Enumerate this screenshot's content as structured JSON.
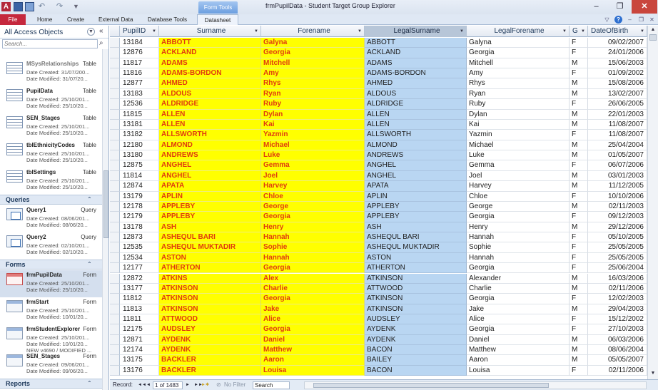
{
  "window": {
    "app_letter": "A",
    "title": "frmPupilData - Student Target Group Explorer",
    "context_tab": "Form Tools"
  },
  "ribbon": {
    "tabs": [
      "File",
      "Home",
      "Create",
      "External Data",
      "Database Tools",
      "Datasheet"
    ]
  },
  "nav": {
    "header": "All Access Objects",
    "search_placeholder": "Search...",
    "items_top": [
      {
        "name": "",
        "type": "",
        "line1": "Date Modified: 31/07/20...",
        "line2": "",
        "line3": "",
        "icon": "table"
      },
      {
        "name": "MSysRelationships",
        "type": "Table",
        "line1": "Date Created: 31/07/200...",
        "line2": "Date Modified: 31/07/20...",
        "line3": "",
        "icon": "table",
        "dim": true
      },
      {
        "name": "PupilData",
        "type": "Table",
        "line1": "Date Created: 25/10/201...",
        "line2": "Date Modified: 25/10/20...",
        "line3": "",
        "icon": "table"
      },
      {
        "name": "SEN_Stages",
        "type": "Table",
        "line1": "Date Created: 25/10/201...",
        "line2": "Date Modified: 25/10/20...",
        "line3": "",
        "icon": "table"
      },
      {
        "name": "tblEthnicityCodes",
        "type": "Table",
        "line1": "Date Created: 25/10/201...",
        "line2": "Date Modified: 25/10/20...",
        "line3": "",
        "icon": "table"
      },
      {
        "name": "tblSettings",
        "type": "Table",
        "line1": "Date Created: 25/10/201...",
        "line2": "Date Modified: 25/10/20...",
        "line3": "",
        "icon": "table"
      }
    ],
    "queries_title": "Queries",
    "queries": [
      {
        "name": "Query1",
        "type": "Query",
        "line1": "Date Created: 08/06/201...",
        "line2": "Date Modified: 08/06/20...",
        "line3": ""
      },
      {
        "name": "Query2",
        "type": "Query",
        "line1": "Date Created: 02/10/201...",
        "line2": "Date Modified: 02/10/20...",
        "line3": ""
      }
    ],
    "forms_title": "Forms",
    "forms": [
      {
        "name": "frmPupilData",
        "type": "Form",
        "line1": "Date Created: 25/10/201...",
        "line2": "Date Modified: 25/10/20...",
        "line3": "",
        "selected": true
      },
      {
        "name": "frmStart",
        "type": "Form",
        "line1": "Date Created: 25/10/201...",
        "line2": "Date Modified: 10/01/20...",
        "line3": ""
      },
      {
        "name": "frmStudentExplorer",
        "type": "Form",
        "line1": "Date Created: 25/10/201...",
        "line2": "Date Modified: 10/01/20...",
        "line3": "NEW v4690 / MODIFIED ..."
      },
      {
        "name": "SEN_Stages",
        "type": "Form",
        "line1": "Date Created: 09/06/201...",
        "line2": "Date Modified: 09/06/20...",
        "line3": ""
      }
    ],
    "reports_title": "Reports"
  },
  "grid": {
    "columns": [
      "PupilID",
      "Surname",
      "Forename",
      "LegalSurname",
      "LegalForename",
      "G",
      "DateOfBirth"
    ],
    "rows": [
      [
        "13184",
        "ABBOTT",
        "Galyna",
        "ABBOTT",
        "Galyna",
        "F",
        "09/02/2007"
      ],
      [
        "12876",
        "ACKLAND",
        "Georgia",
        "ACKLAND",
        "Georgia",
        "F",
        "24/01/2006"
      ],
      [
        "11817",
        "ADAMS",
        "Mitchell",
        "ADAMS",
        "Mitchell",
        "M",
        "15/06/2003"
      ],
      [
        "11816",
        "ADAMS-BORDON",
        "Amy",
        "ADAMS-BORDON",
        "Amy",
        "F",
        "01/09/2002"
      ],
      [
        "12877",
        "AHMED",
        "Rhys",
        "AHMED",
        "Rhys",
        "M",
        "15/08/2006"
      ],
      [
        "13183",
        "ALDOUS",
        "Ryan",
        "ALDOUS",
        "Ryan",
        "M",
        "13/02/2007"
      ],
      [
        "12536",
        "ALDRIDGE",
        "Ruby",
        "ALDRIDGE",
        "Ruby",
        "F",
        "26/06/2005"
      ],
      [
        "11815",
        "ALLEN",
        "Dylan",
        "ALLEN",
        "Dylan",
        "M",
        "22/01/2003"
      ],
      [
        "13181",
        "ALLEN",
        "Kai",
        "ALLEN",
        "Kai",
        "M",
        "11/08/2007"
      ],
      [
        "13182",
        "ALLSWORTH",
        "Yazmin",
        "ALLSWORTH",
        "Yazmin",
        "F",
        "11/08/2007"
      ],
      [
        "12180",
        "ALMOND",
        "Michael",
        "ALMOND",
        "Michael",
        "M",
        "25/04/2004"
      ],
      [
        "13180",
        "ANDREWS",
        "Luke",
        "ANDREWS",
        "Luke",
        "M",
        "01/05/2007"
      ],
      [
        "12875",
        "ANGHEL",
        "Gemma",
        "ANGHEL",
        "Gemma",
        "F",
        "06/07/2006"
      ],
      [
        "11814",
        "ANGHEL",
        "Joel",
        "ANGHEL",
        "Joel",
        "M",
        "03/01/2003"
      ],
      [
        "12874",
        "APATA",
        "Harvey",
        "APATA",
        "Harvey",
        "M",
        "11/12/2005"
      ],
      [
        "13179",
        "APLIN",
        "Chloe",
        "APLIN",
        "Chloe",
        "F",
        "10/10/2006"
      ],
      [
        "12178",
        "APPLEBY",
        "George",
        "APPLEBY",
        "George",
        "M",
        "02/11/2003"
      ],
      [
        "12179",
        "APPLEBY",
        "Georgia",
        "APPLEBY",
        "Georgia",
        "F",
        "09/12/2003"
      ],
      [
        "13178",
        "ASH",
        "Henry",
        "ASH",
        "Henry",
        "M",
        "29/12/2006"
      ],
      [
        "12873",
        "ASHEQUL BARI",
        "Hannah",
        "ASHEQUL BARI",
        "Hannah",
        "F",
        "05/10/2005"
      ],
      [
        "12535",
        "ASHEQUL MUKTADIR",
        "Sophie",
        "ASHEQUL MUKTADIR",
        "Sophie",
        "F",
        "25/05/2005"
      ],
      [
        "12534",
        "ASTON",
        "Hannah",
        "ASTON",
        "Hannah",
        "F",
        "25/05/2005"
      ],
      [
        "12177",
        "ATHERTON",
        "Georgia",
        "ATHERTON",
        "Georgia",
        "F",
        "25/06/2004"
      ],
      [
        "12872",
        "ATKINS",
        "Alex",
        "ATKINSON",
        "Alexander",
        "M",
        "16/03/2006"
      ],
      [
        "13177",
        "ATKINSON",
        "Charlie",
        "ATTWOOD",
        "Charlie",
        "M",
        "02/11/2006"
      ],
      [
        "11812",
        "ATKINSON",
        "Georgia",
        "ATKINSON",
        "Georgia",
        "F",
        "12/02/2003"
      ],
      [
        "11813",
        "ATKINSON",
        "Jake",
        "ATKINSON",
        "Jake",
        "M",
        "29/04/2003"
      ],
      [
        "11811",
        "ATTWOOD",
        "Alice",
        "AUDSLEY",
        "Alice",
        "F",
        "15/12/2002"
      ],
      [
        "12175",
        "AUDSLEY",
        "Georgia",
        "AYDENK",
        "Georgia",
        "F",
        "27/10/2003"
      ],
      [
        "12871",
        "AYDENK",
        "Daniel",
        "AYDENK",
        "Daniel",
        "M",
        "06/03/2006"
      ],
      [
        "12174",
        "AYDENK",
        "Matthew",
        "BACON",
        "Matthew",
        "M",
        "08/06/2004"
      ],
      [
        "13175",
        "BACKLER",
        "Aaron",
        "BAILEY",
        "Aaron",
        "M",
        "05/05/2007"
      ],
      [
        "13176",
        "BACKLER",
        "Louisa",
        "BACON",
        "Louisa",
        "F",
        "02/11/2006"
      ]
    ]
  },
  "recordbar": {
    "label": "Record:",
    "first": "◄◄",
    "prev": "◄",
    "position": "1 of 1483",
    "next": "►",
    "last": "►►",
    "new": "►✱",
    "filter": "No Filter",
    "search": "Search"
  },
  "colors": {
    "highlight_yellow": "#ffff00",
    "highlight_text": "#e03a10",
    "selected_column": "#b9d6f2",
    "file_tab": "#c5283d"
  }
}
